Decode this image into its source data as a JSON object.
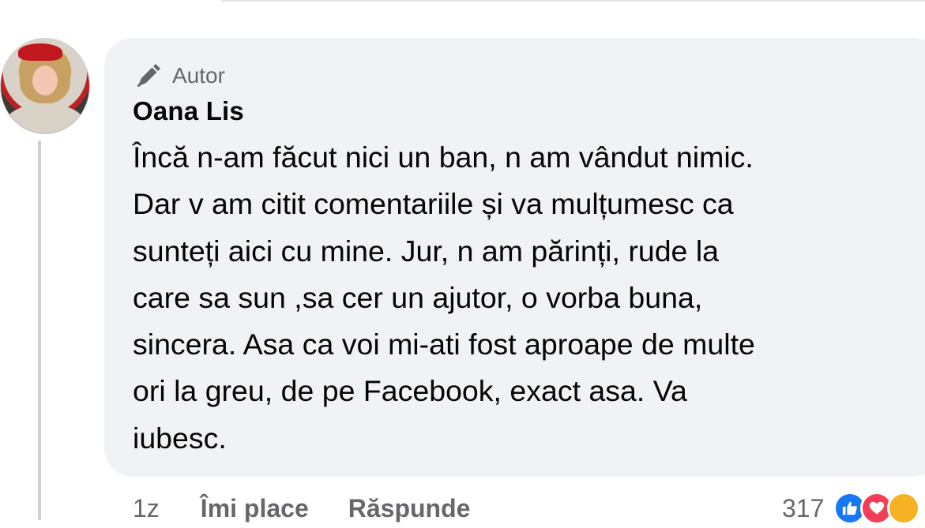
{
  "comment": {
    "author_badge": "Autor",
    "author_name": "Oana Lis",
    "lines": [
      "Încă n-am făcut nici un ban, n am vândut nimic.",
      "Dar v am citit comentariile și va mulțumesc ca",
      "sunteți aici cu mine. Jur, n am părinți, rude la",
      "care sa sun ,sa cer un ajutor, o vorba buna,",
      "sincera. Asa ca voi mi-ati fost aproape de multe",
      "ori la greu, de pe Facebook,  exact asa. Va",
      "iubesc."
    ]
  },
  "footer": {
    "time": "1z",
    "like_label": "Îmi place",
    "reply_label": "Răspunde",
    "reaction_count": "317"
  },
  "icons": {
    "author_badge": "pen-icon",
    "reactions": [
      "like-reaction-icon",
      "love-reaction-icon",
      "haha-reaction-icon"
    ]
  },
  "colors": {
    "bubble": "#f0f2f5",
    "secondary_text": "#65676b",
    "like_blue": "#1877f2",
    "love_red": "#f33e58"
  }
}
